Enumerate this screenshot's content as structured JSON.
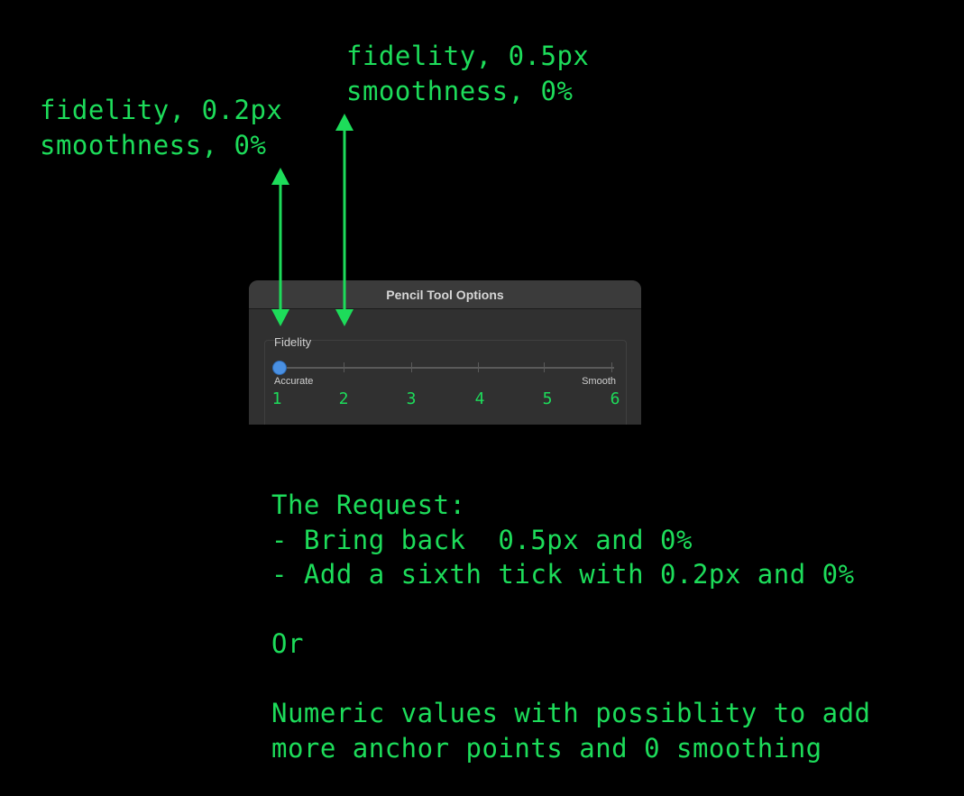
{
  "annotations": {
    "left_note": [
      "fidelity, 0.2px",
      "smoothness, 0%"
    ],
    "right_note": [
      "fidelity, 0.5px",
      "smoothness, 0%"
    ],
    "arrow_color": "#1ddc5a"
  },
  "dialog": {
    "title": "Pencil Tool Options",
    "group_label": "Fidelity",
    "slider": {
      "min_label": "Accurate",
      "max_label": "Smooth",
      "tick_count": 6,
      "selected_tick": 1,
      "tick_numbers": [
        "1",
        "2",
        "3",
        "4",
        "5",
        "6"
      ],
      "thumb_color": "#4a90e2"
    }
  },
  "request": {
    "heading": "The Request:",
    "bullets": [
      "- Bring back  0.5px and 0%",
      "- Add a sixth tick with 0.2px and 0%"
    ],
    "separator": "Or",
    "alternative": [
      "Numeric values with possiblity to add",
      "more anchor points and 0 smoothing"
    ]
  },
  "colors": {
    "background": "#000000",
    "text_green": "#1ddc5a",
    "dialog_bg": "#303030",
    "titlebar_bg": "#3b3b3b"
  }
}
